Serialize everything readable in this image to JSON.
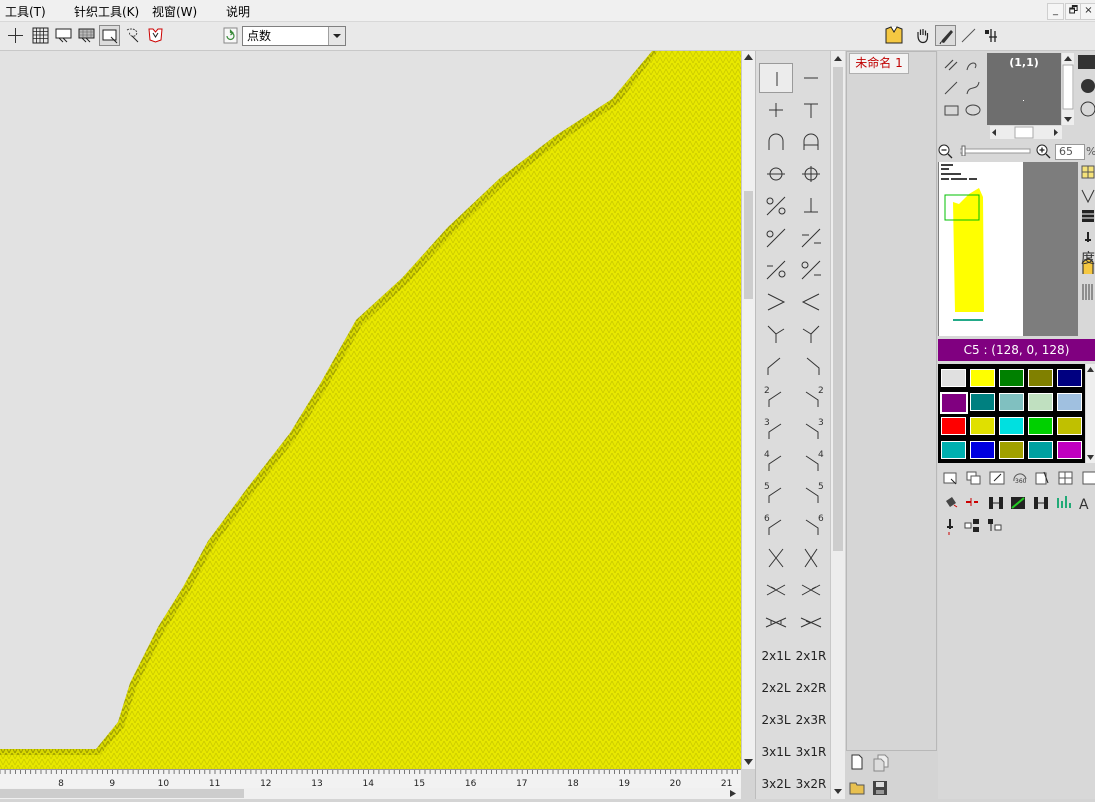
{
  "menu": {
    "tools": "工具(T)",
    "knit_tools": "针织工具(K)",
    "window": "视窗(W)",
    "help": "说明"
  },
  "window_buttons": {
    "minimize": "_",
    "restore": "🗗",
    "close": "×"
  },
  "toolbar": {
    "mode_select": "点数"
  },
  "palette": {
    "labels": [
      "2x1L",
      "2x1R",
      "2x2L",
      "2x2R",
      "2x3L",
      "2x3R",
      "3x1L",
      "3x1R",
      "3x2L",
      "3x2R"
    ],
    "num_marks": [
      "2",
      "2",
      "3",
      "3",
      "4",
      "4",
      "5",
      "5",
      "6",
      "6"
    ]
  },
  "document": {
    "tab": "未命名 1"
  },
  "navigator": {
    "coords": "(1,1)",
    "zoom": "65",
    "zoom_unit": "%"
  },
  "color_info": "C5 : (128, 0, 128)",
  "side_glyph": "度",
  "ruler": {
    "ticks": [
      "8",
      "9",
      "10",
      "11",
      "12",
      "13",
      "14",
      "15",
      "16",
      "17",
      "18",
      "19",
      "20",
      "21"
    ]
  },
  "colors": {
    "knit_fill": "#e8e800",
    "swatches": [
      "#e0e0e0",
      "#ffff00",
      "#008000",
      "#808000",
      "#000080",
      "#800080",
      "#008080",
      "#80c0c0",
      "#c0e0c0",
      "#a0c0e0",
      "#ff0000",
      "#e0e000",
      "#00e0e0",
      "#00d000",
      "#c0c000",
      "#00b0b0",
      "#0000e0",
      "#a0a000",
      "#00a0a0",
      "#c000c0"
    ],
    "color_info_bg": "#800080"
  }
}
